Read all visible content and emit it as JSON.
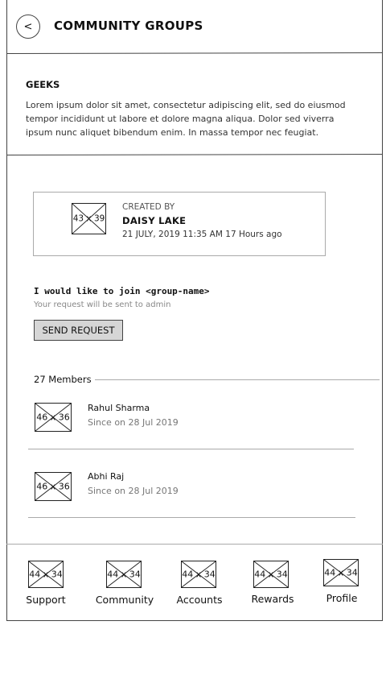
{
  "header": {
    "back_label": "<",
    "title": "COMMUNITY GROUPS"
  },
  "group": {
    "name": "GEEKS",
    "description": "Lorem ipsum dolor sit amet, consectetur adipiscing elit, sed do eiusmod tempor incididunt ut labore et dolore magna aliqua. Dolor sed viverra ipsum nunc aliquet bibendum enim. In massa tempor nec feugiat."
  },
  "creator": {
    "image_label": "43 x 39",
    "created_label": "CREATED BY",
    "name": "DAISY LAKE",
    "date": "21 JULY, 2019 11:35 AM 17 Hours ago"
  },
  "join": {
    "text": "I would like to join <group-name>",
    "subtext": "Your request will be sent to admin",
    "button_label": "SEND REQUEST"
  },
  "members": {
    "count_label": "27 Members",
    "items": [
      {
        "image_label": "46 x 36",
        "name": "Rahul Sharma",
        "since": "Since on 28 Jul 2019"
      },
      {
        "image_label": "46 x 36",
        "name": "Abhi Raj",
        "since": "Since on 28 Jul 2019"
      }
    ]
  },
  "bottom_nav": {
    "items": [
      {
        "label": "Support",
        "image_label": "44 x 34"
      },
      {
        "label": "Community",
        "image_label": "44 x 34"
      },
      {
        "label": "Accounts",
        "image_label": "44 x 34"
      },
      {
        "label": "Rewards",
        "image_label": "44 x 34"
      },
      {
        "label": "Profile",
        "image_label": "44 x 34"
      }
    ]
  }
}
